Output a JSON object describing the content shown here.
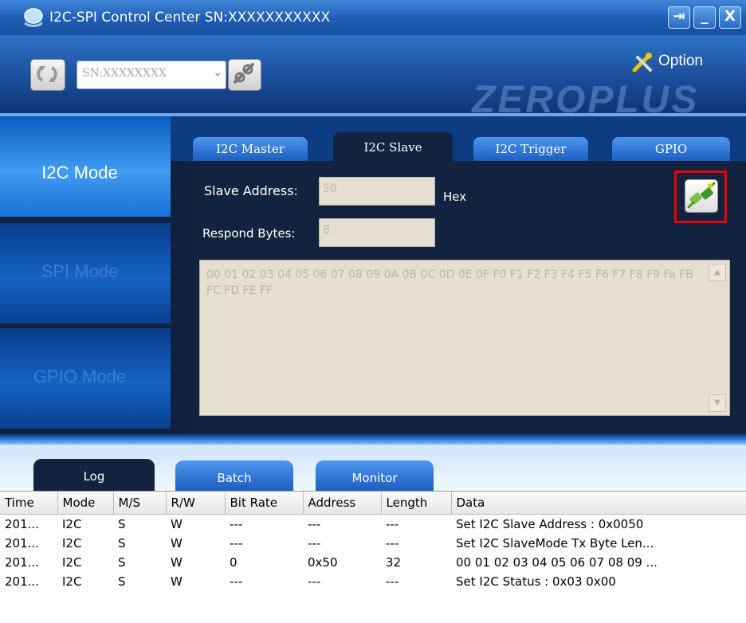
{
  "window": {
    "title": "I2C-SPI Control Center  SN:XXXXXXXXXXX",
    "buttons": [
      "⇥",
      "_",
      "X"
    ]
  },
  "header": {
    "serial_select": "SN:XXXXXXXX",
    "option_label": "Option",
    "brand": "ZEROPLUS"
  },
  "modes": [
    {
      "label": "I2C Mode",
      "active": true
    },
    {
      "label": "SPI Mode",
      "active": false
    },
    {
      "label": "GPIO Mode",
      "active": false
    }
  ],
  "tabs": [
    {
      "label": "I2C Master",
      "active": false
    },
    {
      "label": "I2C Slave",
      "active": true
    },
    {
      "label": "I2C Trigger",
      "active": false
    },
    {
      "label": "GPIO",
      "active": false
    }
  ],
  "slave": {
    "address_label": "Slave Address:",
    "address_value": "50",
    "address_unit": "Hex",
    "respond_label": "Respond Bytes:",
    "respond_value": "8",
    "data_text": "00 01 02 03 04 05 06 07 08 09 0A 0B 0C 0D 0E 0F F0 F1 F2 F3 F4 F5 F6 F7 F8 F9 Fa FB FC FD FE FF"
  },
  "log_tabs": [
    {
      "label": "Log",
      "active": true
    },
    {
      "label": "Batch",
      "active": false
    },
    {
      "label": "Monitor",
      "active": false
    }
  ],
  "log": {
    "columns": [
      "Time",
      "Mode",
      "M/S",
      "R/W",
      "Bit Rate",
      "Address",
      "Length",
      "Data"
    ],
    "rows": [
      [
        "201...",
        "I2C",
        "S",
        "W",
        "---",
        "---",
        "---",
        "Set I2C Slave Address : 0x0050"
      ],
      [
        "201...",
        "I2C",
        "S",
        "W",
        "---",
        "---",
        "---",
        "Set I2C SlaveMode Tx Byte Len..."
      ],
      [
        "201...",
        "I2C",
        "S",
        "W",
        "0",
        "0x50",
        "32",
        "00 01 02 03 04 05 06 07 08 09 ..."
      ],
      [
        "201...",
        "I2C",
        "S",
        "W",
        "---",
        "---",
        "---",
        "Set I2C Status : 0x03 0x00"
      ]
    ]
  },
  "colors": {
    "titlebar": "#1e5db5",
    "main_bg": "#10203f",
    "active_mode": "#3f9df2",
    "highlight_border": "#e00000"
  },
  "icons": {
    "app": "app-logo-icon",
    "refresh": "refresh-icon",
    "disconnect": "disconnect-icon",
    "option": "wrench-screwdriver-icon",
    "connect": "plug-connect-icon"
  }
}
